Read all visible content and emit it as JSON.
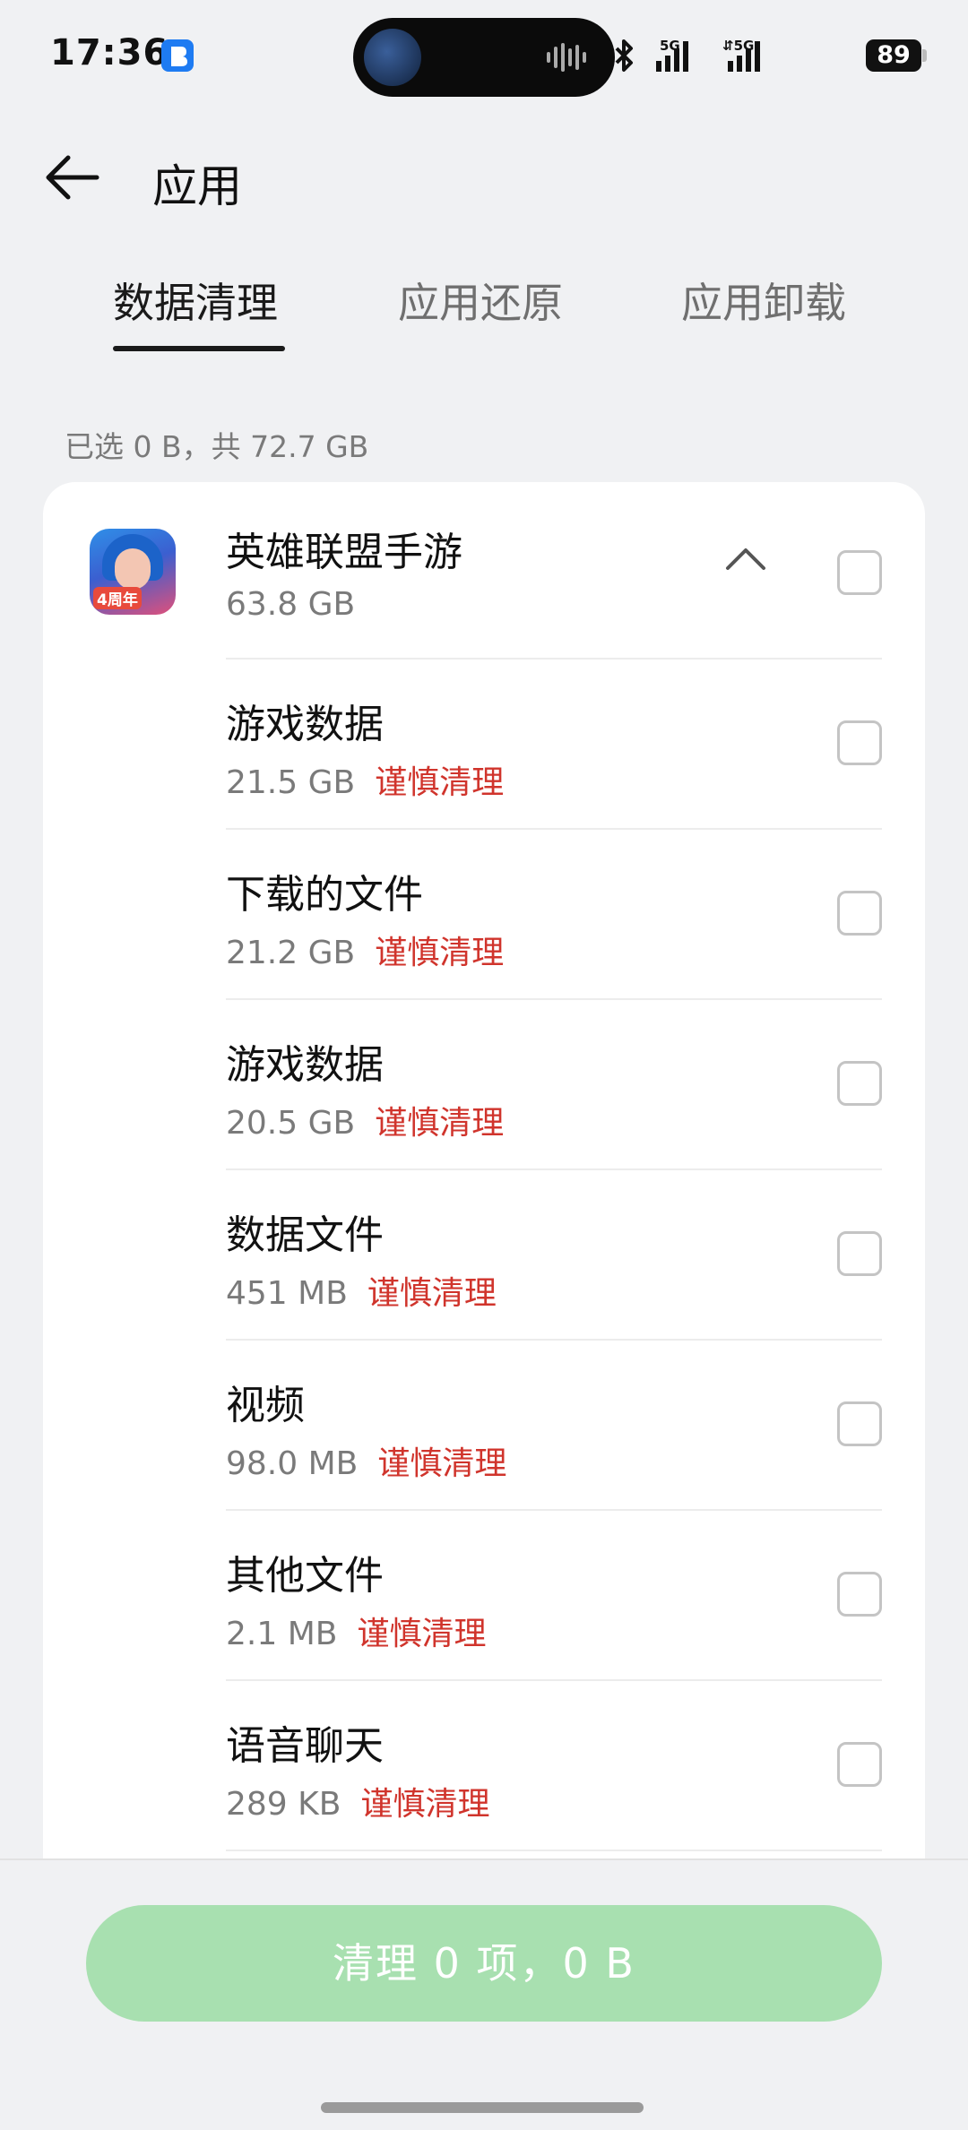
{
  "status_bar": {
    "time": "17:36",
    "notification_icon": "blue-app-notification",
    "network_1": "5G",
    "network_2": "5G",
    "battery": "89"
  },
  "header": {
    "title": "应用",
    "back_icon": "arrow-left-icon"
  },
  "tabs": [
    {
      "label": "数据清理",
      "active": true
    },
    {
      "label": "应用还原",
      "active": false
    },
    {
      "label": "应用卸载",
      "active": false
    }
  ],
  "summary": "已选 0 B，共 72.7 GB",
  "app": {
    "name": "英雄联盟手游",
    "size": "63.8 GB",
    "icon_badge": "4周年",
    "expanded": true,
    "checked": false
  },
  "items": [
    {
      "name": "游戏数据",
      "size": "21.5 GB",
      "warning": "谨慎清理",
      "checked": false
    },
    {
      "name": "下载的文件",
      "size": "21.2 GB",
      "warning": "谨慎清理",
      "checked": false
    },
    {
      "name": "游戏数据",
      "size": "20.5 GB",
      "warning": "谨慎清理",
      "checked": false
    },
    {
      "name": "数据文件",
      "size": "451 MB",
      "warning": "谨慎清理",
      "checked": false
    },
    {
      "name": "视频",
      "size": "98.0 MB",
      "warning": "谨慎清理",
      "checked": false
    },
    {
      "name": "其他文件",
      "size": "2.1 MB",
      "warning": "谨慎清理",
      "checked": false
    },
    {
      "name": "语音聊天",
      "size": "289 KB",
      "warning": "谨慎清理",
      "checked": false
    }
  ],
  "bottom": {
    "clean_button_label": "清理 0 项，0 B",
    "clean_button_enabled": false
  },
  "colors": {
    "warning": "#d0342c",
    "button_disabled": "#a8e0b0",
    "background": "#f0f1f3"
  }
}
